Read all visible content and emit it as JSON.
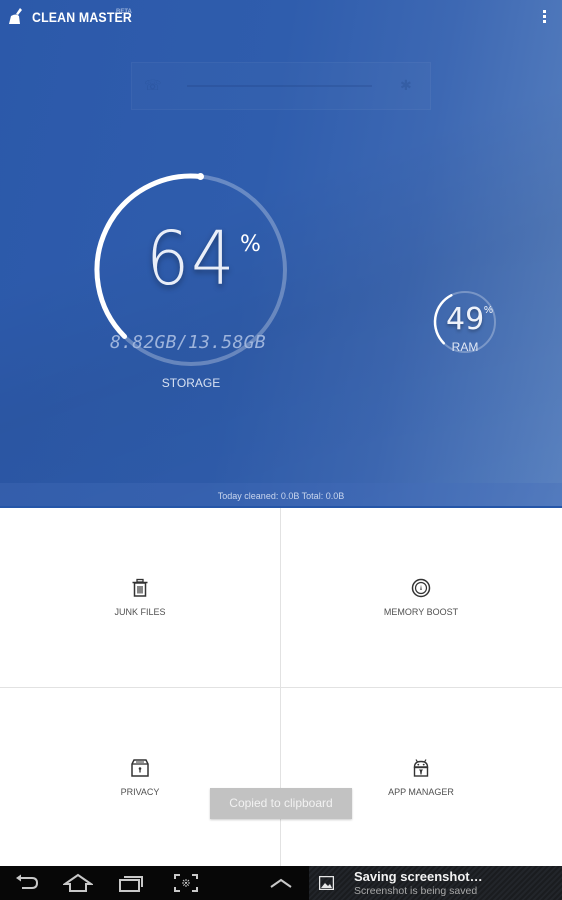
{
  "app": {
    "title": "CLEAN MASTER",
    "badge": "BETA",
    "brand_color": "#2c59aa"
  },
  "storage": {
    "percent_value": "64",
    "percent_sign": "%",
    "percent_used": 64,
    "detail": "8.82GB/13.58GB",
    "label": "STORAGE"
  },
  "ram": {
    "percent_value": "49",
    "percent_sign": "%",
    "percent_used": 49,
    "label": "RAM"
  },
  "stats": {
    "text": "Today cleaned: 0.0B  Total: 0.0B"
  },
  "tiles": [
    {
      "label": "JUNK FILES",
      "icon": "trash-icon"
    },
    {
      "label": "MEMORY BOOST",
      "icon": "gauge-icon"
    },
    {
      "label": "PRIVACY",
      "icon": "locked-box-icon"
    },
    {
      "label": "APP MANAGER",
      "icon": "android-lock-icon"
    }
  ],
  "toast": {
    "text": "Copied to clipboard"
  },
  "navbar": {
    "buttons": [
      "back-icon",
      "home-icon",
      "recent-apps-icon",
      "screenshot-icon",
      "chevron-up-icon"
    ]
  },
  "notification": {
    "title": "Saving screenshot…",
    "subtitle": "Screenshot is being saved"
  }
}
